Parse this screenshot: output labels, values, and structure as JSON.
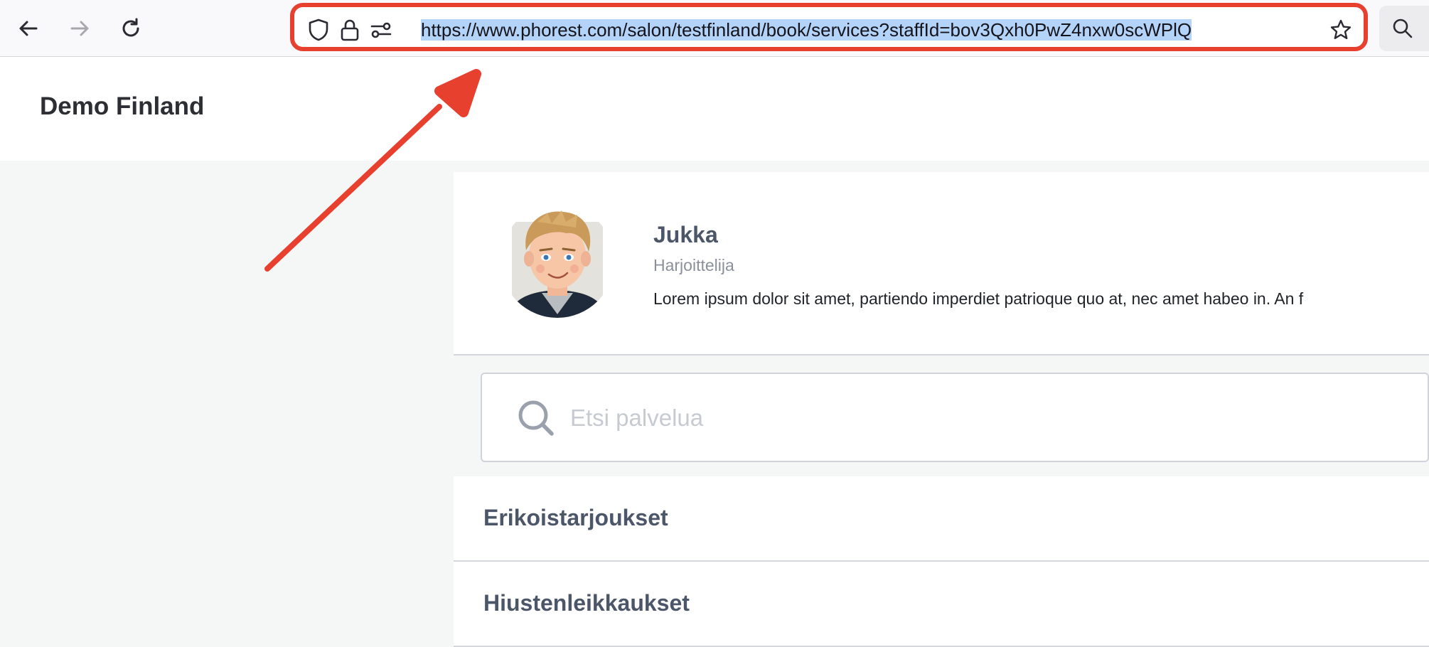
{
  "browser": {
    "url": "https://www.phorest.com/salon/testfinland/book/services?staffId=bov3Qxh0PwZ4nxw0scWPlQ",
    "icons": [
      "back-icon",
      "forward-icon",
      "reload-icon",
      "shield-icon",
      "lock-icon",
      "permissions-icon",
      "bookmark-star-icon",
      "search-icon"
    ]
  },
  "header": {
    "salon_name": "Demo Finland"
  },
  "staff": {
    "name": "Jukka",
    "role": "Harjoittelija",
    "bio": "Lorem ipsum dolor sit amet, partiendo imperdiet patrioque quo at, nec amet habeo in. An f"
  },
  "search": {
    "placeholder": "Etsi palvelua",
    "value": ""
  },
  "categories": [
    {
      "label": "Erikoistarjoukset"
    },
    {
      "label": "Hiustenleikkaukset"
    }
  ],
  "colors": {
    "annotation": "#e8402f",
    "selection": "#b4d3f9",
    "heading": "#4c5669"
  }
}
